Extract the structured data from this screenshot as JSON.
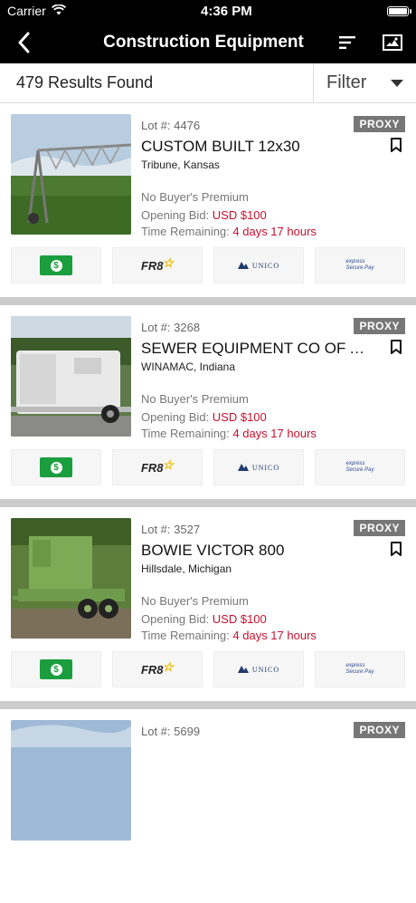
{
  "status": {
    "carrier": "Carrier",
    "time": "4:36 PM"
  },
  "header": {
    "title": "Construction Equipment"
  },
  "results": {
    "count_text": "479 Results Found",
    "filter_label": "Filter"
  },
  "labels": {
    "lot_prefix": "Lot #: ",
    "premium": "No Buyer's Premium",
    "opening_prefix": "Opening Bid: ",
    "remaining_prefix": "Time Remaining: ",
    "proxy": "PROXY"
  },
  "payment_logos": {
    "fr8": "FR8",
    "unico": "UNICO",
    "express1": "express",
    "express2": "Secure Pay"
  },
  "items": [
    {
      "lot": "4476",
      "name": "CUSTOM BUILT 12x30",
      "location": "Tribune, Kansas",
      "opening_bid": "USD $100",
      "time_remaining": "4 days 17 hours"
    },
    {
      "lot": "3268",
      "name": "SEWER EQUIPMENT CO OF AMERICA",
      "location": "WINAMAC, Indiana",
      "opening_bid": "USD $100",
      "time_remaining": "4 days 17 hours"
    },
    {
      "lot": "3527",
      "name": "BOWIE VICTOR 800",
      "location": "Hillsdale, Michigan",
      "opening_bid": "USD $100",
      "time_remaining": "4 days 17 hours"
    },
    {
      "lot": "5699"
    }
  ]
}
